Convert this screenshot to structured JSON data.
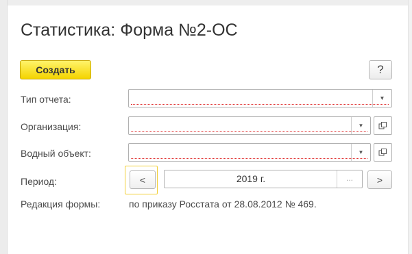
{
  "window": {
    "title": "Статистика: Форма №2-ОС"
  },
  "toolbar": {
    "create_label": "Создать",
    "help_label": "?"
  },
  "form": {
    "report_type": {
      "label": "Тип отчета:",
      "value": ""
    },
    "organization": {
      "label": "Организация:",
      "value": ""
    },
    "water_object": {
      "label": "Водный объект:",
      "value": ""
    },
    "period": {
      "label": "Период:",
      "value": "2019 г.",
      "select_label": "...",
      "prev_label": "<",
      "next_label": ">"
    },
    "edition": {
      "label": "Редакция формы:",
      "value": "по приказу Росстата от 28.08.2012 № 469."
    }
  },
  "icons": {
    "dropdown": "chevron-down-icon",
    "open": "open-form-icon",
    "prev": "chevron-left-icon",
    "next": "chevron-right-icon"
  },
  "colors": {
    "create_button": "#f4d400",
    "required_underline": "#e03030",
    "focus_ring": "#f1cf35"
  }
}
